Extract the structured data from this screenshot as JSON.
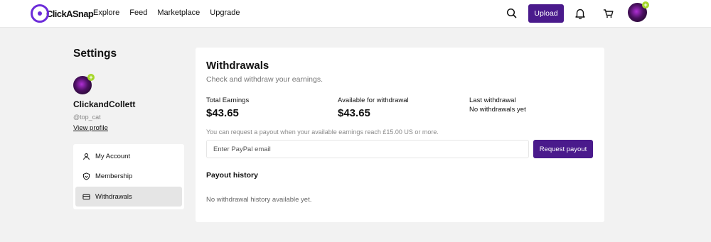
{
  "header": {
    "brand": "ClickASnap",
    "nav": [
      "Explore",
      "Feed",
      "Marketplace",
      "Upgrade"
    ],
    "upload_label": "Upload",
    "avatar_badge": "+"
  },
  "sidebar": {
    "title": "Settings",
    "username": "ClickandCollett",
    "handle": "@top_cat",
    "view_profile": "View profile",
    "items": [
      {
        "label": "My Account",
        "icon": "user-icon"
      },
      {
        "label": "Membership",
        "icon": "shield-icon"
      },
      {
        "label": "Withdrawals",
        "icon": "card-icon",
        "active": true
      }
    ]
  },
  "main": {
    "title": "Withdrawals",
    "subtitle": "Check and withdraw your earnings.",
    "total_earnings_label": "Total Earnings",
    "total_earnings_value": "$43.65",
    "available_label": "Available for withdrawal",
    "available_value": "$43.65",
    "last_withdrawal_label": "Last withdrawal",
    "last_withdrawal_value": "No withdrawals yet",
    "payout_note": "You can request a payout when your available earnings reach £15.00 US or more.",
    "email_placeholder": "Enter PayPal email",
    "request_label": "Request payout",
    "history_title": "Payout history",
    "history_empty": "No withdrawal history available yet."
  },
  "colors": {
    "brand": "#6c2bd9",
    "button": "#4a1a8c",
    "badge": "#a6d72a"
  }
}
